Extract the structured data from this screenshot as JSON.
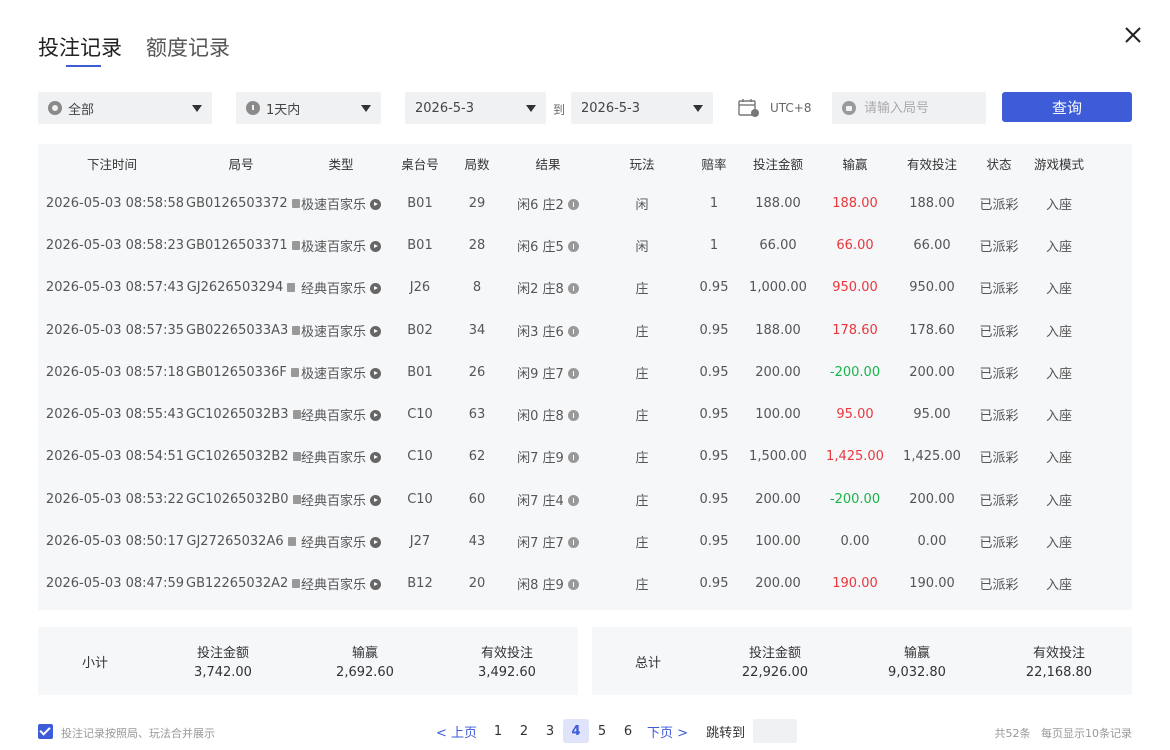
{
  "tabs": [
    "投注记录",
    "额度记录"
  ],
  "filters": {
    "scope": "全部",
    "period": "1天内",
    "date_from": "2026-5-3",
    "to_label": "到",
    "date_to": "2026-5-3",
    "timezone": "UTC+8",
    "search_placeholder": "请输入局号",
    "query_label": "查询"
  },
  "columns": [
    "下注时间",
    "局号",
    "类型",
    "桌台号",
    "局数",
    "结果",
    "玩法",
    "赔率",
    "投注金额",
    "输赢",
    "有效投注",
    "状态",
    "游戏模式"
  ],
  "rows": [
    {
      "time": "2026-05-03 08:58:58",
      "round": "GB0126503372",
      "type": "极速百家乐",
      "table": "B01",
      "num": "29",
      "result": "闲6 庄2",
      "play": "闲",
      "odds": "1",
      "bet": "188.00",
      "win": "188.00",
      "win_color": "red",
      "valid": "188.00",
      "status": "已派彩",
      "mode": "入座"
    },
    {
      "time": "2026-05-03 08:58:23",
      "round": "GB0126503371",
      "type": "极速百家乐",
      "table": "B01",
      "num": "28",
      "result": "闲6 庄5",
      "play": "闲",
      "odds": "1",
      "bet": "66.00",
      "win": "66.00",
      "win_color": "red",
      "valid": "66.00",
      "status": "已派彩",
      "mode": "入座"
    },
    {
      "time": "2026-05-03 08:57:43",
      "round": "GJ2626503294",
      "type": "经典百家乐",
      "table": "J26",
      "num": "8",
      "result": "闲2 庄8",
      "play": "庄",
      "odds": "0.95",
      "bet": "1,000.00",
      "win": "950.00",
      "win_color": "red",
      "valid": "950.00",
      "status": "已派彩",
      "mode": "入座"
    },
    {
      "time": "2026-05-03 08:57:35",
      "round": "GB02265033A3",
      "type": "极速百家乐",
      "table": "B02",
      "num": "34",
      "result": "闲3 庄6",
      "play": "庄",
      "odds": "0.95",
      "bet": "188.00",
      "win": "178.60",
      "win_color": "red",
      "valid": "178.60",
      "status": "已派彩",
      "mode": "入座"
    },
    {
      "time": "2026-05-03 08:57:18",
      "round": "GB012650336F",
      "type": "极速百家乐",
      "table": "B01",
      "num": "26",
      "result": "闲9 庄7",
      "play": "庄",
      "odds": "0.95",
      "bet": "200.00",
      "win": "-200.00",
      "win_color": "green",
      "valid": "200.00",
      "status": "已派彩",
      "mode": "入座"
    },
    {
      "time": "2026-05-03 08:55:43",
      "round": "GC10265032B3",
      "type": "经典百家乐",
      "table": "C10",
      "num": "63",
      "result": "闲0 庄8",
      "play": "庄",
      "odds": "0.95",
      "bet": "100.00",
      "win": "95.00",
      "win_color": "red",
      "valid": "95.00",
      "status": "已派彩",
      "mode": "入座"
    },
    {
      "time": "2026-05-03 08:54:51",
      "round": "GC10265032B2",
      "type": "经典百家乐",
      "table": "C10",
      "num": "62",
      "result": "闲7 庄9",
      "play": "庄",
      "odds": "0.95",
      "bet": "1,500.00",
      "win": "1,425.00",
      "win_color": "red",
      "valid": "1,425.00",
      "status": "已派彩",
      "mode": "入座"
    },
    {
      "time": "2026-05-03 08:53:22",
      "round": "GC10265032B0",
      "type": "经典百家乐",
      "table": "C10",
      "num": "60",
      "result": "闲7 庄4",
      "play": "庄",
      "odds": "0.95",
      "bet": "200.00",
      "win": "-200.00",
      "win_color": "green",
      "valid": "200.00",
      "status": "已派彩",
      "mode": "入座"
    },
    {
      "time": "2026-05-03 08:50:17",
      "round": "GJ27265032A6",
      "type": "经典百家乐",
      "table": "J27",
      "num": "43",
      "result": "闲7 庄7",
      "play": "庄",
      "odds": "0.95",
      "bet": "100.00",
      "win": "0.00",
      "win_color": "normal",
      "valid": "0.00",
      "status": "已派彩",
      "mode": "入座"
    },
    {
      "time": "2026-05-03 08:47:59",
      "round": "GB12265032A2",
      "type": "经典百家乐",
      "table": "B12",
      "num": "20",
      "result": "闲8 庄9",
      "play": "庄",
      "odds": "0.95",
      "bet": "200.00",
      "win": "190.00",
      "win_color": "red",
      "valid": "190.00",
      "status": "已派彩",
      "mode": "入座"
    }
  ],
  "subtotal": {
    "label": "小计",
    "bet_h": "投注金额",
    "bet": "3,742.00",
    "win_h": "输赢",
    "win": "2,692.60",
    "valid_h": "有效投注",
    "valid": "3,492.60"
  },
  "total": {
    "label": "总计",
    "bet_h": "投注金额",
    "bet": "22,926.00",
    "win_h": "输赢",
    "win": "9,032.80",
    "valid_h": "有效投注",
    "valid": "22,168.80"
  },
  "footer": {
    "merge_label": "投注记录按照局、玩法合并展示",
    "prev": "< 上页",
    "pages": [
      "1",
      "2",
      "3",
      "4",
      "5",
      "6"
    ],
    "current_page": "4",
    "next": "下页 >",
    "jump_label": "跳转到",
    "total_label": "共52条",
    "per_page_label": "每页显示10条记录"
  },
  "colors": {
    "accent": "#3e5bd8",
    "win": "#e8373d",
    "loss": "#19b34a"
  }
}
